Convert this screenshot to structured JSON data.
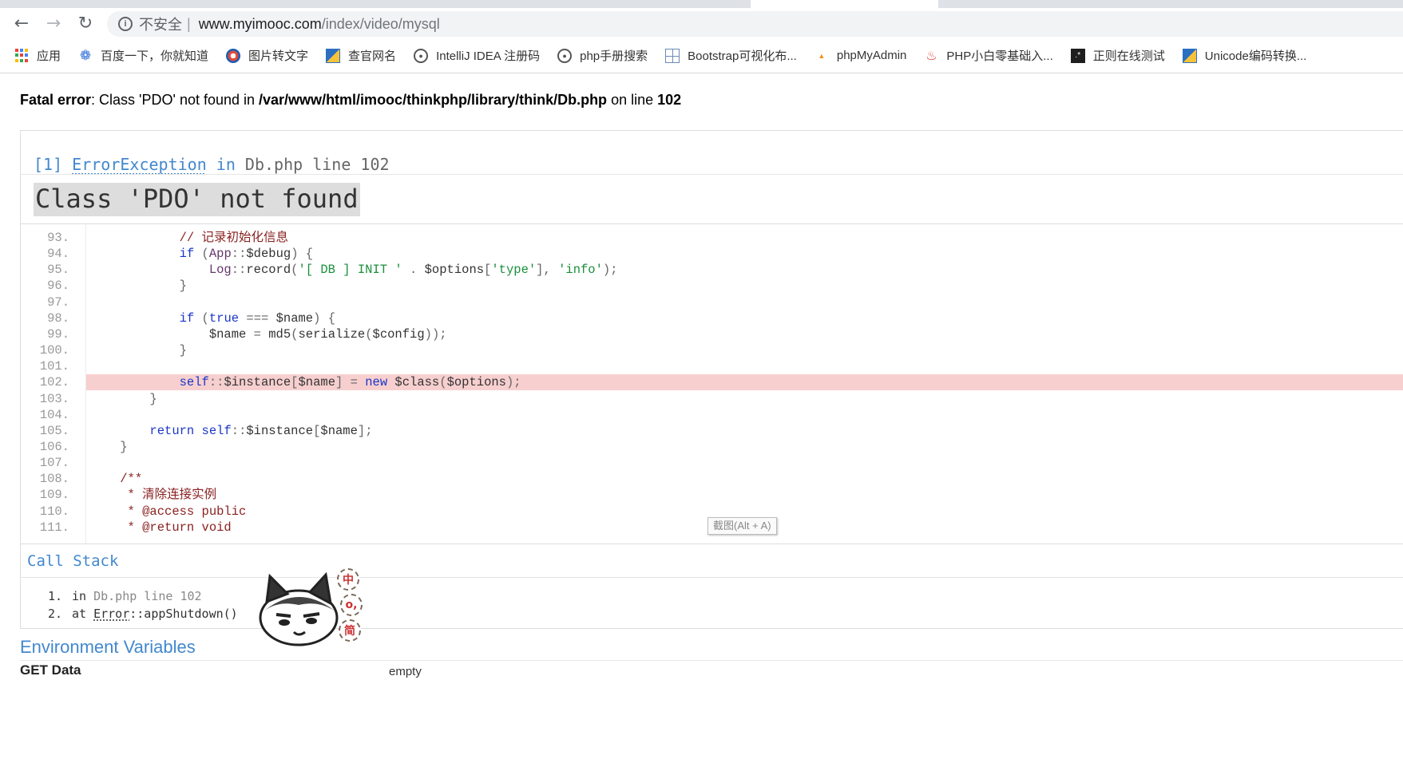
{
  "browser": {
    "security_label": "不安全",
    "url_host": "www.myimooc.com",
    "url_path": "/index/video/mysql",
    "bookmarks": [
      {
        "label": "应用",
        "icon": "apps-grid-icon"
      },
      {
        "label": "百度一下，你就知道",
        "icon": "baidu-paw-icon"
      },
      {
        "label": "图片转文字",
        "icon": "image-ocr-icon"
      },
      {
        "label": "查官网名",
        "icon": "book-icon"
      },
      {
        "label": "IntelliJ IDEA 注册码",
        "icon": "globe-icon"
      },
      {
        "label": "php手册搜索",
        "icon": "globe-icon"
      },
      {
        "label": "Bootstrap可视化布...",
        "icon": "layout-grid-icon"
      },
      {
        "label": "phpMyAdmin",
        "icon": "phpmyadmin-icon"
      },
      {
        "label": "PHP小白零基础入...",
        "icon": "flame-icon"
      },
      {
        "label": "正则在线测试",
        "icon": "regex-icon"
      },
      {
        "label": "Unicode编码转换...",
        "icon": "book-icon"
      }
    ]
  },
  "fatal": {
    "prefix": "Fatal error",
    "message": ": Class 'PDO' not found in ",
    "file": "/var/www/html/imooc/thinkphp/library/think/Db.php",
    "on_line": " on line ",
    "line": "102"
  },
  "exception": {
    "index": "[1]",
    "class": "ErrorException",
    "in": " in ",
    "location": "Db.php line 102",
    "message": "Class 'PDO' not found"
  },
  "source": {
    "lines": [
      {
        "no": "93.",
        "html": "            <span class=\"cm\">// 记录初始化信息</span>"
      },
      {
        "no": "94.",
        "html": "            <span class=\"k\">if</span> <span class=\"pun\">(</span><span class=\"cls\">App</span><span class=\"pun\">::</span>$debug<span class=\"pun\">) {</span>"
      },
      {
        "no": "95.",
        "html": "                <span class=\"cls\">Log</span><span class=\"pun\">::</span>record<span class=\"pun\">(</span><span class=\"str\">'[ DB ] INIT '</span> <span class=\"pun\">.</span> $options<span class=\"pun\">[</span><span class=\"str\">'type'</span><span class=\"pun\">],</span> <span class=\"str\">'info'</span><span class=\"pun\">);</span>"
      },
      {
        "no": "96.",
        "html": "            <span class=\"pun\">}</span>"
      },
      {
        "no": "97.",
        "html": ""
      },
      {
        "no": "98.",
        "html": "            <span class=\"k\">if</span> <span class=\"pun\">(</span><span class=\"k\">true</span> <span class=\"pun\">===</span> $name<span class=\"pun\">) {</span>"
      },
      {
        "no": "99.",
        "html": "                $name <span class=\"pun\">=</span> md5<span class=\"pun\">(</span>serialize<span class=\"pun\">(</span>$config<span class=\"pun\">));</span>"
      },
      {
        "no": "100.",
        "html": "            <span class=\"pun\">}</span>"
      },
      {
        "no": "101.",
        "html": ""
      },
      {
        "no": "102.",
        "html": "            <span class=\"k\">self</span><span class=\"pun\">::</span>$instance<span class=\"pun\">[</span>$name<span class=\"pun\">] =</span> <span class=\"k\">new</span> $class<span class=\"pun\">(</span>$options<span class=\"pun\">);</span>",
        "highlight": true
      },
      {
        "no": "103.",
        "html": "        <span class=\"pun\">}</span>"
      },
      {
        "no": "104.",
        "html": ""
      },
      {
        "no": "105.",
        "html": "        <span class=\"k\">return</span> <span class=\"k\">self</span><span class=\"pun\">::</span>$instance<span class=\"pun\">[</span>$name<span class=\"pun\">];</span>"
      },
      {
        "no": "106.",
        "html": "    <span class=\"pun\">}</span>"
      },
      {
        "no": "107.",
        "html": ""
      },
      {
        "no": "108.",
        "html": "    <span class=\"cm\">/**</span>"
      },
      {
        "no": "109.",
        "html": "     <span class=\"cm\">* 清除连接实例</span>"
      },
      {
        "no": "110.",
        "html": "     <span class=\"cm\">* @access public</span>"
      },
      {
        "no": "111.",
        "html": "     <span class=\"cm\">* @return void</span>"
      }
    ]
  },
  "screenshot_tip": "截图(Alt + A)",
  "callstack": {
    "title": "Call Stack",
    "items": [
      {
        "num": "1.",
        "prefix": "in ",
        "file": "Db.php line 102",
        "abbr": "",
        "rest": ""
      },
      {
        "num": "2.",
        "prefix": "at ",
        "file": "",
        "abbr": "Error",
        "rest": "::appShutdown()"
      }
    ]
  },
  "env": {
    "title": "Environment Variables",
    "get_label": "GET Data",
    "get_value": "empty"
  },
  "ime": {
    "buttons": [
      "中",
      "o,",
      "简"
    ]
  }
}
